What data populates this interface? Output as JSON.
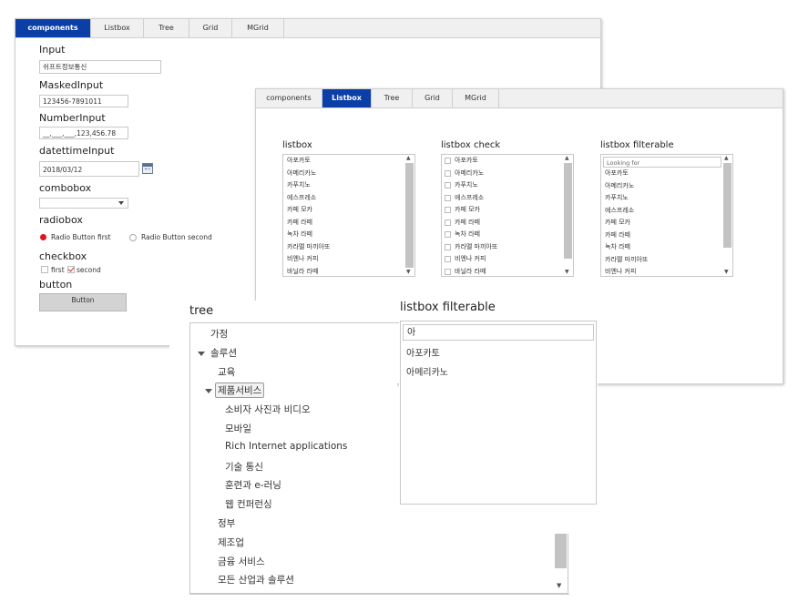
{
  "panel1": {
    "tabs": [
      "components",
      "Listbox",
      "Tree",
      "Grid",
      "MGrid"
    ],
    "input": {
      "label": "Input",
      "value": "쉬프트정보통신"
    },
    "masked": {
      "label": "MaskedInput",
      "value": "123456-7891011"
    },
    "number": {
      "label": "NumberInput",
      "value": "__,___,___,123,456.78"
    },
    "datetime": {
      "label": "datettimeInput",
      "value": "2018/03/12"
    },
    "combobox": {
      "label": "combobox",
      "value": ""
    },
    "radiobox": {
      "label": "radiobox",
      "first": "Radio Button first",
      "second": "Radio Button second"
    },
    "checkbox": {
      "label": "checkbox",
      "first": "first",
      "second": "second"
    },
    "button": {
      "label": "button",
      "text": "Button"
    }
  },
  "panel2": {
    "tabs": [
      "components",
      "Listbox",
      "Tree",
      "Grid",
      "MGrid"
    ],
    "listbox": {
      "label": "listbox",
      "items": [
        "아포카토",
        "아메리카노",
        "카푸치노",
        "에스프레소",
        "카페 모카",
        "카페 라떼",
        "녹차 라떼",
        "카라멜 마끼아또",
        "비엔나 커피",
        "바닐라 라떼"
      ]
    },
    "listbox_check": {
      "label": "listbox check",
      "items": [
        "아포카토",
        "아메리카노",
        "카푸치노",
        "에스프레소",
        "카페 모카",
        "카페 라떼",
        "녹차 라떼",
        "카라멜 마끼아또",
        "비엔나 커피",
        "바닐라 라떼"
      ]
    },
    "listbox_filter": {
      "label": "listbox filterable",
      "placeholder": "Looking for",
      "items": [
        "아포카토",
        "아메리카노",
        "카푸치노",
        "에스프레소",
        "카페 모카",
        "카페 라떼",
        "녹차 라떼",
        "카라멜 마끼아또",
        "비엔나 커피"
      ]
    }
  },
  "tree": {
    "label": "tree",
    "items": [
      {
        "text": "가정",
        "level": 0
      },
      {
        "text": "솔루션",
        "level": 0,
        "expanded": true
      },
      {
        "text": "교육",
        "level": 1
      },
      {
        "text": "제품서비스",
        "level": 1,
        "expanded": true,
        "selected": true
      },
      {
        "text": "소비자 사진과 비디오",
        "level": 2
      },
      {
        "text": "모바일",
        "level": 2
      },
      {
        "text": "Rich Internet applications",
        "level": 2
      },
      {
        "text": "기술 통신",
        "level": 2
      },
      {
        "text": "훈련과 e-러닝",
        "level": 2
      },
      {
        "text": "웹 컨퍼런싱",
        "level": 2
      },
      {
        "text": "정부",
        "level": 1
      },
      {
        "text": "제조업",
        "level": 1
      },
      {
        "text": "금융 서비스",
        "level": 1
      },
      {
        "text": "모든 산업과 솔루션",
        "level": 1
      }
    ]
  },
  "filter_big": {
    "label": "listbox filterable",
    "value": "아",
    "items": [
      "아포카토",
      "아메리카노"
    ]
  },
  "colors": {
    "accent": "#0c3ea8",
    "radio_selected": "#e0141e",
    "check": "#d9272e"
  }
}
